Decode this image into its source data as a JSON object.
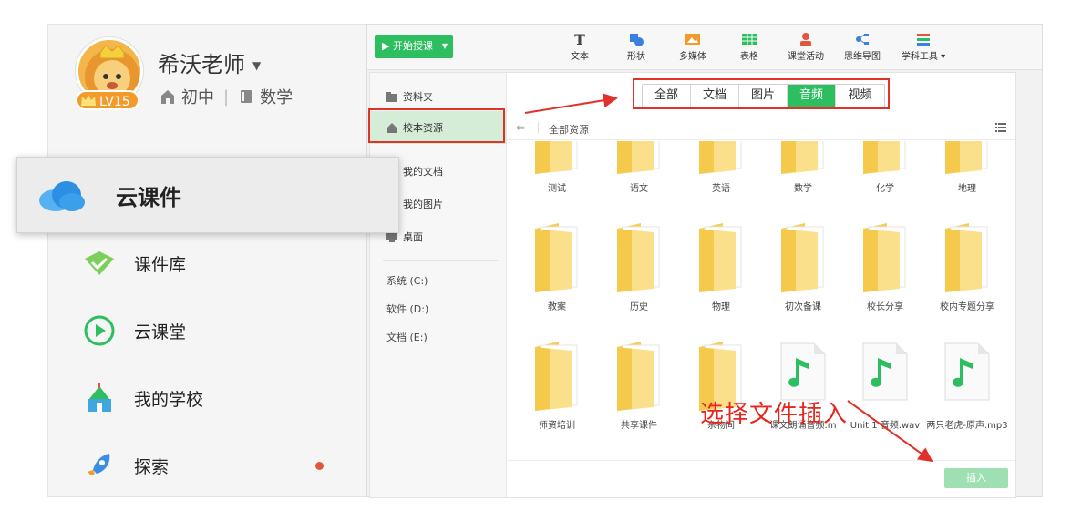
{
  "profile": {
    "name": "希沃老师",
    "level": "LV15",
    "grade": "初中",
    "subject": "数学"
  },
  "left_nav": [
    {
      "label": "云课件",
      "icon": "cloud-icon"
    },
    {
      "label": "课件库",
      "icon": "courseware-library-icon"
    },
    {
      "label": "云课堂",
      "icon": "play-circle-icon"
    },
    {
      "label": "我的学校",
      "icon": "school-icon"
    },
    {
      "label": "探索",
      "icon": "rocket-icon"
    }
  ],
  "toolbar": {
    "start_class": "开始授课",
    "tools": [
      {
        "label": "文本",
        "icon": "text-icon"
      },
      {
        "label": "形状",
        "icon": "shape-icon"
      },
      {
        "label": "多媒体",
        "icon": "multimedia-icon"
      },
      {
        "label": "表格",
        "icon": "table-icon"
      },
      {
        "label": "课堂活动",
        "icon": "class-activity-icon"
      },
      {
        "label": "思维导图",
        "icon": "mindmap-icon"
      },
      {
        "label": "学科工具",
        "icon": "subject-tools-icon"
      }
    ]
  },
  "dialog": {
    "sidebar": [
      "资料夹",
      "校本资源",
      "我的文档",
      "我的图片",
      "桌面"
    ],
    "drives": [
      "系统 (C:)",
      "软件 (D:)",
      "文档 (E:)"
    ],
    "filter_tabs": [
      "全部",
      "文档",
      "图片",
      "音频",
      "视频"
    ],
    "active_filter": "音频",
    "path": "全部资源",
    "files": [
      {
        "name": "测试",
        "type": "folder"
      },
      {
        "name": "语文",
        "type": "folder"
      },
      {
        "name": "英语",
        "type": "folder"
      },
      {
        "name": "数学",
        "type": "folder"
      },
      {
        "name": "化学",
        "type": "folder"
      },
      {
        "name": "地理",
        "type": "folder"
      },
      {
        "name": "教案",
        "type": "folder"
      },
      {
        "name": "历史",
        "type": "folder"
      },
      {
        "name": "物理",
        "type": "folder"
      },
      {
        "name": "初次备课",
        "type": "folder"
      },
      {
        "name": "校长分享",
        "type": "folder"
      },
      {
        "name": "校内专题分享",
        "type": "folder"
      },
      {
        "name": "师资培训",
        "type": "folder"
      },
      {
        "name": "共享课件",
        "type": "folder"
      },
      {
        "name": "杂物间",
        "type": "folder"
      },
      {
        "name": "课文朗诵音频.m",
        "type": "audio"
      },
      {
        "name": "Unit 1 音频.wav",
        "type": "audio"
      },
      {
        "name": "两只老虎-原声.mp3",
        "type": "audio"
      }
    ],
    "insert_label": "插入"
  },
  "annotation": {
    "text": "选择文件插入"
  },
  "colors": {
    "accent_green": "#2dbe60",
    "annotation_red": "#e0322a",
    "folder_yellow": "#f9d66e"
  }
}
